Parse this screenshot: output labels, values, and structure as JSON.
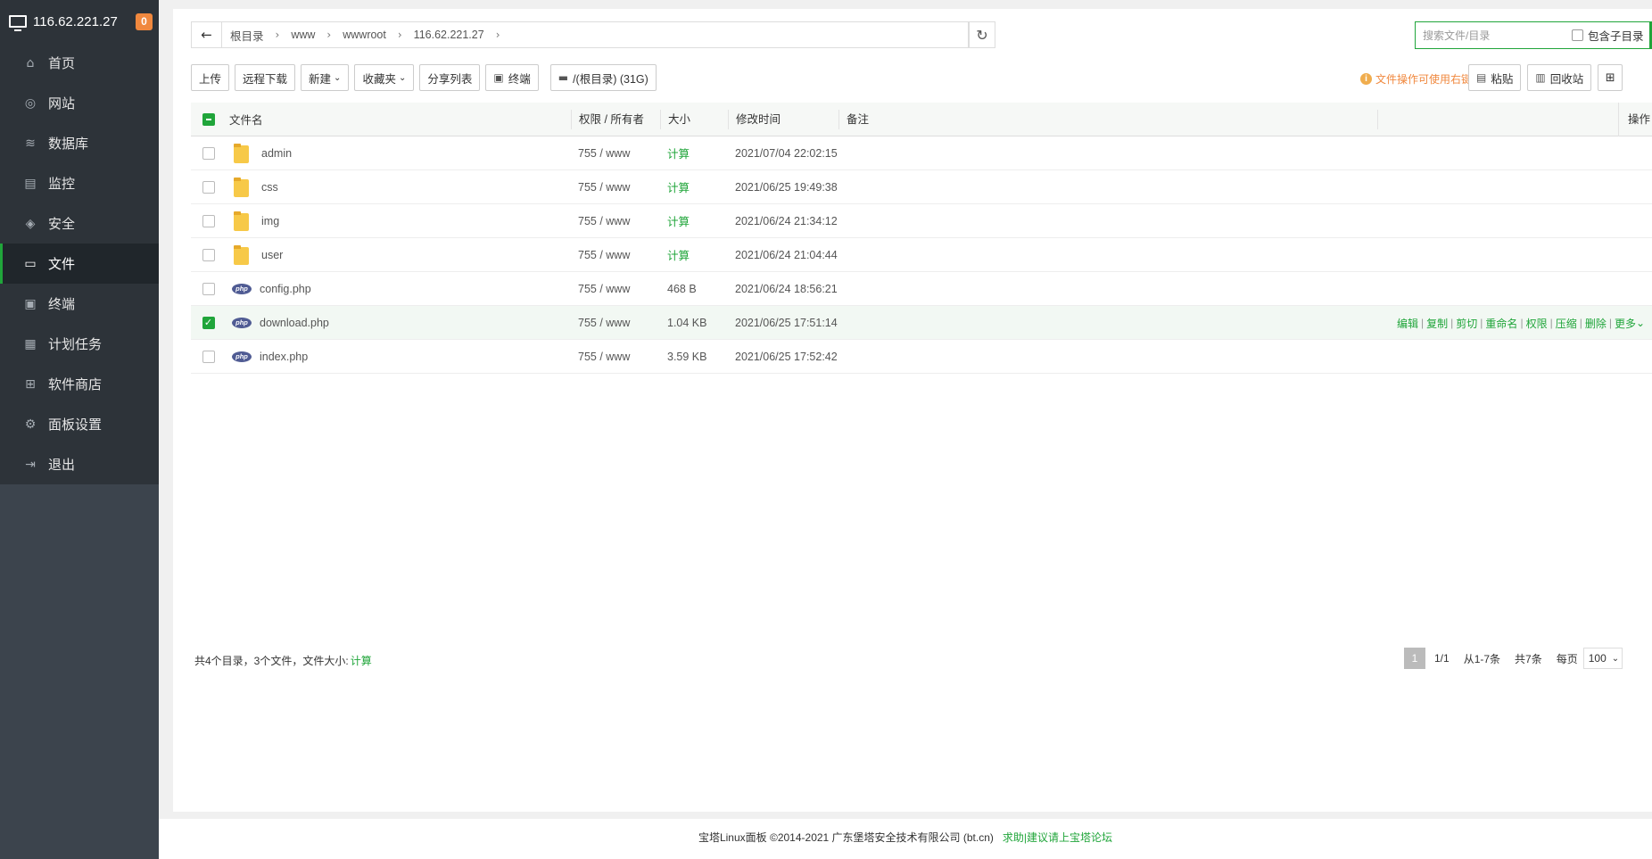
{
  "sidebar": {
    "ip": "116.62.221.27",
    "badge": "0",
    "items": [
      {
        "label": "首页",
        "icon": "home-icon",
        "glyph": "⌂"
      },
      {
        "label": "网站",
        "icon": "globe-icon",
        "glyph": "◎"
      },
      {
        "label": "数据库",
        "icon": "database-icon",
        "glyph": "≋"
      },
      {
        "label": "监控",
        "icon": "monitor-icon",
        "glyph": "▤"
      },
      {
        "label": "安全",
        "icon": "shield-icon",
        "glyph": "◈"
      },
      {
        "label": "文件",
        "icon": "folder-icon",
        "glyph": "▭"
      },
      {
        "label": "终端",
        "icon": "terminal-icon",
        "glyph": "▣"
      },
      {
        "label": "计划任务",
        "icon": "calendar-icon",
        "glyph": "▦"
      },
      {
        "label": "软件商店",
        "icon": "apps-icon",
        "glyph": "⊞"
      },
      {
        "label": "面板设置",
        "icon": "gear-icon",
        "glyph": "⚙"
      },
      {
        "label": "退出",
        "icon": "logout-icon",
        "glyph": "⇥"
      }
    ]
  },
  "path": {
    "crumbs": [
      "根目录",
      "www",
      "wwwroot",
      "116.62.221.27"
    ]
  },
  "search": {
    "placeholder": "搜索文件/目录",
    "include_sub": "包含子目录"
  },
  "toolbar": {
    "upload": "上传",
    "remote_download": "远程下载",
    "new": "新建",
    "favorites": "收藏夹",
    "share_list": "分享列表",
    "terminal": "终端",
    "disk": "/(根目录) (31G)",
    "hint": "文件操作可使用右键",
    "paste": "粘贴",
    "recycle": "回收站"
  },
  "table": {
    "headers": {
      "name": "文件名",
      "perm": "权限 / 所有者",
      "size": "大小",
      "time": "修改时间",
      "note": "备注",
      "ops": "操作"
    },
    "rows": [
      {
        "name": "admin",
        "type": "folder",
        "perm": "755 / www",
        "size": "计算",
        "time": "2021/07/04 22:02:15"
      },
      {
        "name": "css",
        "type": "folder",
        "perm": "755 / www",
        "size": "计算",
        "time": "2021/06/25 19:49:38"
      },
      {
        "name": "img",
        "type": "folder",
        "perm": "755 / www",
        "size": "计算",
        "time": "2021/06/24 21:34:12"
      },
      {
        "name": "user",
        "type": "folder",
        "perm": "755 / www",
        "size": "计算",
        "time": "2021/06/24 21:04:44"
      },
      {
        "name": "config.php",
        "type": "php",
        "perm": "755 / www",
        "size": "468 B",
        "time": "2021/06/24 18:56:21"
      },
      {
        "name": "download.php",
        "type": "php",
        "perm": "755 / www",
        "size": "1.04 KB",
        "time": "2021/06/25 17:51:14",
        "selected": true
      },
      {
        "name": "index.php",
        "type": "php",
        "perm": "755 / www",
        "size": "3.59 KB",
        "time": "2021/06/25 17:52:42"
      }
    ],
    "row_ops": [
      "编辑",
      "复制",
      "剪切",
      "重命名",
      "权限",
      "压缩",
      "删除",
      "更多"
    ]
  },
  "summary": {
    "text": "共4个目录，3个文件，文件大小:",
    "calc": "计算"
  },
  "pager": {
    "current": "1",
    "pages": "1/1",
    "range": "从1-7条",
    "total": "共7条",
    "per_page_label": "每页",
    "per_page": "100"
  },
  "footer": {
    "copyright": "宝塔Linux面板 ©2014-2021 广东堡塔安全技术有限公司 (bt.cn)",
    "link": "求助|建议请上宝塔论坛"
  },
  "colors": {
    "accent": "#20a53a",
    "sidebar": "#3c444d",
    "warning": "#f0883e"
  }
}
